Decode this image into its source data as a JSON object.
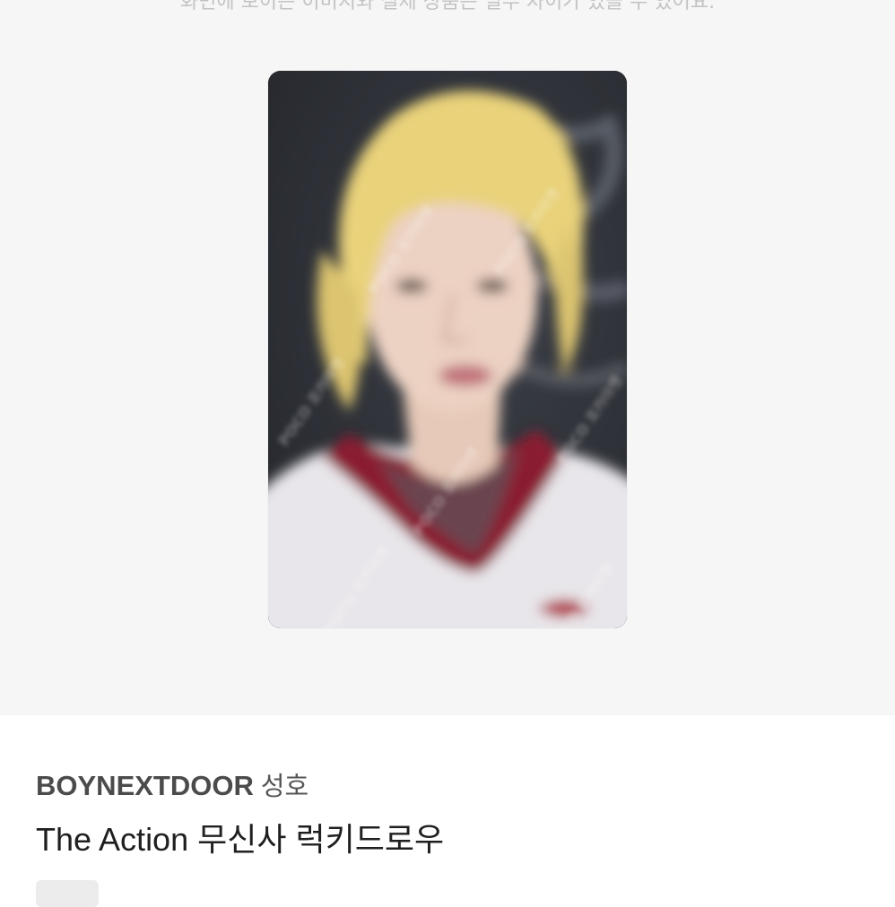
{
  "gallery": {
    "notice": "화면에 보이는 이미지와 실제 상품은 일부 차이가 있을 수 있어요.",
    "watermark": "POCO 포카마켓",
    "card_image": "photocard of blonde idol in white jersey with red collar"
  },
  "product": {
    "artist": "BOYNEXTDOOR",
    "member": "성호",
    "title": "The Action 무신사 럭키드로우"
  },
  "colors": {
    "gallery_bg": "#f6f6f6",
    "card_bg": "#2f3238",
    "hair": "#e9d27a",
    "jersey": "#eceaee",
    "collar": "#8a1f33"
  }
}
